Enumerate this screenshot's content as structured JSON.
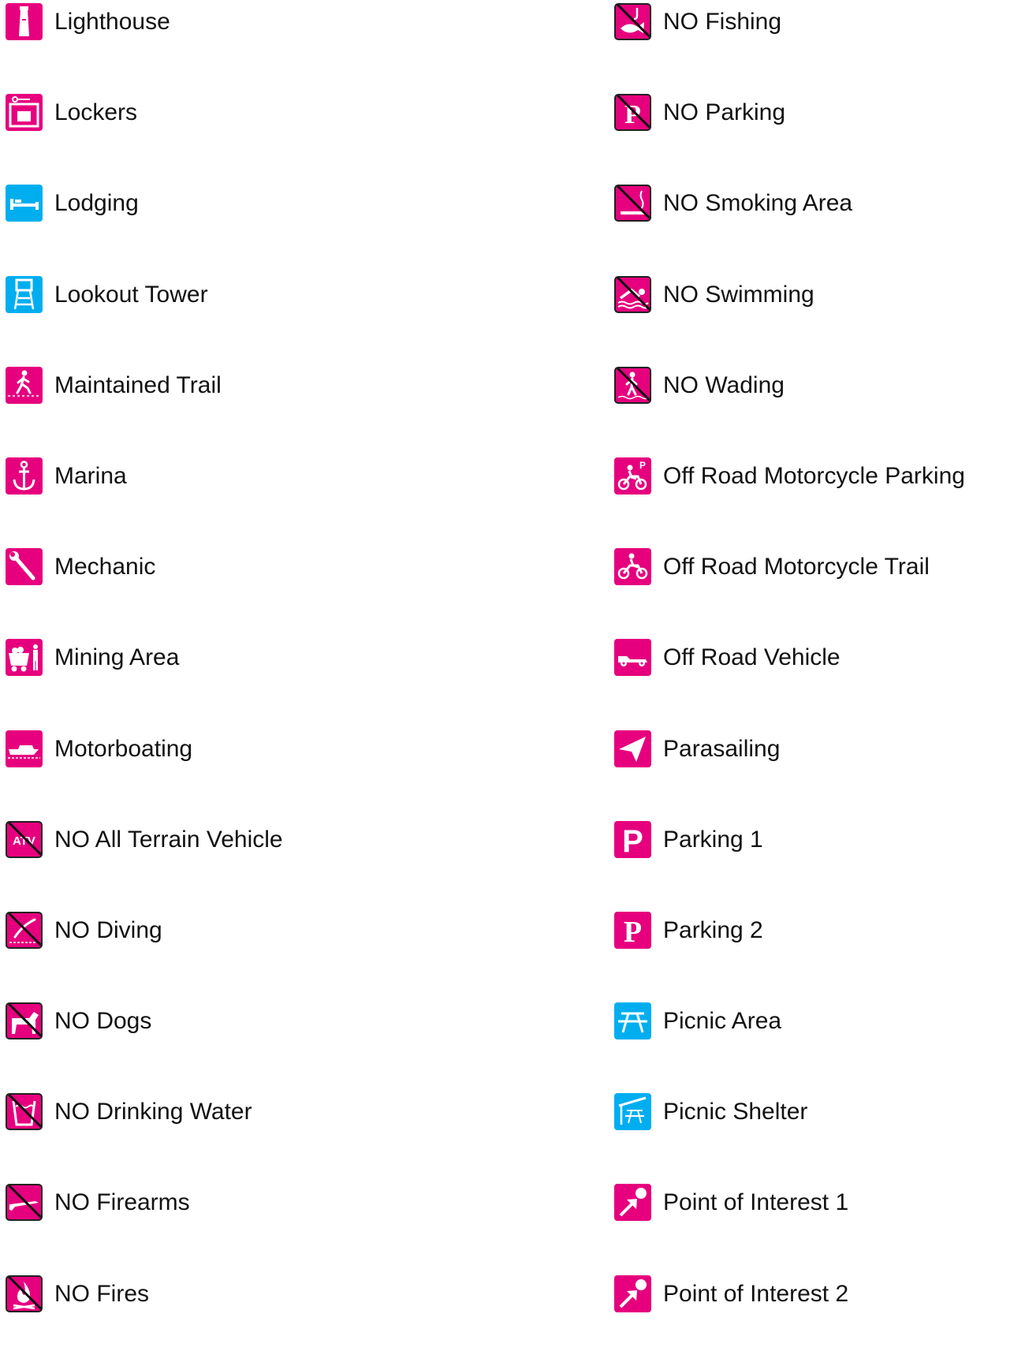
{
  "legend": {
    "left": [
      {
        "label": "Lighthouse",
        "icon": "lighthouse-icon",
        "color": "#e6007e",
        "no": false
      },
      {
        "label": "Lockers",
        "icon": "lockers-icon",
        "color": "#e6007e",
        "no": false
      },
      {
        "label": "Lodging",
        "icon": "lodging-icon",
        "color": "#00aeef",
        "no": false
      },
      {
        "label": "Lookout Tower",
        "icon": "lookout-tower-icon",
        "color": "#00aeef",
        "no": false
      },
      {
        "label": "Maintained Trail",
        "icon": "hiker-icon",
        "color": "#e6007e",
        "no": false
      },
      {
        "label": "Marina",
        "icon": "anchor-icon",
        "color": "#e6007e",
        "no": false
      },
      {
        "label": "Mechanic",
        "icon": "wrench-icon",
        "color": "#e6007e",
        "no": false
      },
      {
        "label": "Mining Area",
        "icon": "mine-cart-icon",
        "color": "#e6007e",
        "no": false
      },
      {
        "label": "Motorboating",
        "icon": "motorboat-icon",
        "color": "#e6007e",
        "no": false
      },
      {
        "label": "NO All Terrain Vehicle",
        "icon": "atv-icon",
        "color": "#e6007e",
        "no": true
      },
      {
        "label": "NO Diving",
        "icon": "diver-icon",
        "color": "#e6007e",
        "no": true
      },
      {
        "label": "NO Dogs",
        "icon": "dog-icon",
        "color": "#e6007e",
        "no": true
      },
      {
        "label": "NO Drinking Water",
        "icon": "cup-icon",
        "color": "#e6007e",
        "no": true
      },
      {
        "label": "NO Firearms",
        "icon": "rifle-icon",
        "color": "#e6007e",
        "no": true
      },
      {
        "label": "NO Fires",
        "icon": "fire-icon",
        "color": "#e6007e",
        "no": true
      }
    ],
    "right": [
      {
        "label": "NO Fishing",
        "icon": "fish-icon",
        "color": "#e6007e",
        "no": true
      },
      {
        "label": "NO Parking",
        "icon": "parking-p-icon",
        "color": "#e6007e",
        "no": true
      },
      {
        "label": "NO Smoking Area",
        "icon": "cigarette-icon",
        "color": "#e6007e",
        "no": true
      },
      {
        "label": "NO Swimming",
        "icon": "swimmer-icon",
        "color": "#e6007e",
        "no": true
      },
      {
        "label": "NO Wading",
        "icon": "wader-icon",
        "color": "#e6007e",
        "no": true
      },
      {
        "label": "Off Road Motorcycle Parking",
        "icon": "motorcycle-parking-icon",
        "color": "#e6007e",
        "no": false
      },
      {
        "label": "Off Road Motorcycle Trail",
        "icon": "motorcycle-icon",
        "color": "#e6007e",
        "no": false
      },
      {
        "label": "Off Road Vehicle",
        "icon": "jeep-icon",
        "color": "#e6007e",
        "no": false
      },
      {
        "label": "Parasailing",
        "icon": "parasail-icon",
        "color": "#e6007e",
        "no": false
      },
      {
        "label": "Parking 1",
        "icon": "parking-p-icon",
        "color": "#e6007e",
        "no": false
      },
      {
        "label": "Parking 2",
        "icon": "parking-p-serif-icon",
        "color": "#e6007e",
        "no": false
      },
      {
        "label": "Picnic Area",
        "icon": "picnic-table-icon",
        "color": "#00aeef",
        "no": false
      },
      {
        "label": "Picnic Shelter",
        "icon": "picnic-shelter-icon",
        "color": "#00aeef",
        "no": false
      },
      {
        "label": "Point of Interest 1",
        "icon": "point-of-interest-icon",
        "color": "#e6007e",
        "no": false
      },
      {
        "label": "Point of Interest 2",
        "icon": "point-of-interest-icon",
        "color": "#e6007e",
        "no": false
      }
    ],
    "icon_glyph_text": {
      "atv": "ATV",
      "parking": "P"
    }
  }
}
